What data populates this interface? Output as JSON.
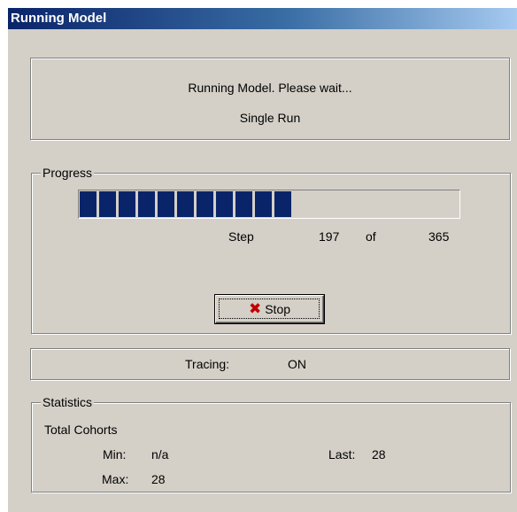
{
  "window": {
    "title": "Running Model"
  },
  "status": {
    "message": "Running Model.  Please wait...",
    "mode": "Single Run"
  },
  "progress": {
    "label": "Progress",
    "step_label": "Step",
    "current_step": "197",
    "of_label": "of",
    "total_steps": "365",
    "fraction": 0.54,
    "segments_filled": 11
  },
  "buttons": {
    "stop_label": "Stop",
    "stop_icon": "red-x-icon"
  },
  "tracing": {
    "label": "Tracing:",
    "value": "ON"
  },
  "statistics": {
    "label": "Statistics",
    "total_cohorts_label": "Total Cohorts",
    "min_label": "Min:",
    "min_value": "n/a",
    "max_label": "Max:",
    "max_value": "28",
    "last_label": "Last:",
    "last_value": "28"
  },
  "colors": {
    "progress_fill": "#0a246a",
    "dialog_face": "#d4d0c8",
    "stop_icon": "#c00000"
  }
}
